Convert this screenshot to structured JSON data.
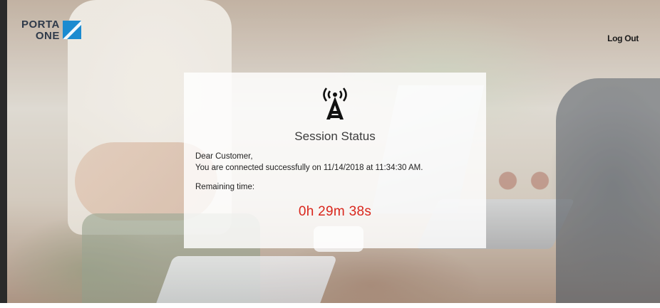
{
  "brand": {
    "logo_line1": "PORTA",
    "logo_line2": "ONE",
    "logo_color": "#1b8bd0"
  },
  "header": {
    "logout_label": "Log Out"
  },
  "session": {
    "icon": "radio-tower-icon",
    "title": "Session Status",
    "greeting": "Dear Customer,",
    "message": "You are connected successfully on 11/14/2018 at 11:34:30 AM.",
    "remaining_label": "Remaining time:",
    "remaining_time": "0h 29m 38s",
    "timer_color": "#d9261c"
  }
}
